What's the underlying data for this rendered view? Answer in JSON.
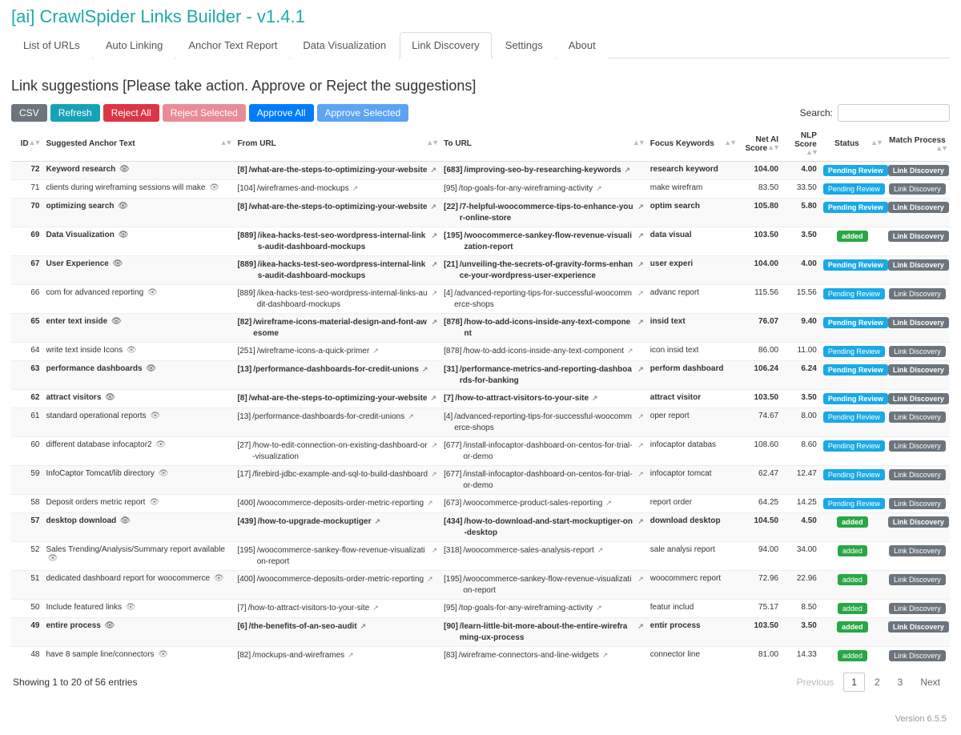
{
  "app_title": "[ai] CrawlSpider Links Builder - v1.4.1",
  "tabs": [
    "List of URLs",
    "Auto Linking",
    "Anchor Text Report",
    "Data Visualization",
    "Link Discovery",
    "Settings",
    "About"
  ],
  "active_tab": 4,
  "subtitle": "Link suggestions [Please take action. Approve or Reject the suggestions]",
  "toolbar": {
    "csv": "CSV",
    "refresh": "Refresh",
    "reject_all": "Reject All",
    "reject_selected": "Reject Selected",
    "approve_all": "Approve All",
    "approve_selected": "Approve Selected"
  },
  "search_label": "Search:",
  "columns": {
    "id": "ID",
    "anchor": "Suggested Anchor Text",
    "from": "From URL",
    "to": "To URL",
    "focus": "Focus Keywords",
    "net": "Net AI Score",
    "nlp": "NLP Score",
    "status": "Status",
    "match": "Match Process"
  },
  "status_labels": {
    "pending": "Pending Review",
    "added": "added"
  },
  "match_label": "Link Discovery",
  "rows": [
    {
      "id": 72,
      "bold": true,
      "anchor": "Keyword research",
      "from_id": 8,
      "from": "/what-are-the-steps-to-optimizing-your-website",
      "to_id": 683,
      "to": "/improving-seo-by-researching-keywords",
      "focus": "research keyword",
      "net": "104.00",
      "nlp": "4.00",
      "status": "pending"
    },
    {
      "id": 71,
      "bold": false,
      "anchor": "clients during wireframing sessions will make",
      "from_id": 104,
      "from": "/wireframes-and-mockups",
      "to_id": 95,
      "to": "/top-goals-for-any-wireframing-activity",
      "focus": "make wirefram",
      "net": "83.50",
      "nlp": "33.50",
      "status": "pending"
    },
    {
      "id": 70,
      "bold": true,
      "anchor": "optimizing search",
      "from_id": 8,
      "from": "/what-are-the-steps-to-optimizing-your-website",
      "to_id": 22,
      "to": "/7-helpful-woocommerce-tips-to-enhance-your-online-store",
      "focus": "optim search",
      "net": "105.80",
      "nlp": "5.80",
      "status": "pending"
    },
    {
      "id": 69,
      "bold": true,
      "anchor": "Data Visualization",
      "from_id": 889,
      "from": "/ikea-hacks-test-seo-wordpress-internal-links-audit-dashboard-mockups",
      "to_id": 195,
      "to": "/woocommerce-sankey-flow-revenue-visualization-report",
      "focus": "data visual",
      "net": "103.50",
      "nlp": "3.50",
      "status": "added"
    },
    {
      "id": 67,
      "bold": true,
      "anchor": "User Experience",
      "from_id": 889,
      "from": "/ikea-hacks-test-seo-wordpress-internal-links-audit-dashboard-mockups",
      "to_id": 21,
      "to": "/unveiling-the-secrets-of-gravity-forms-enhance-your-wordpress-user-experience",
      "focus": "user experi",
      "net": "104.00",
      "nlp": "4.00",
      "status": "pending"
    },
    {
      "id": 66,
      "bold": false,
      "anchor": "com for advanced reporting",
      "from_id": 889,
      "from": "/ikea-hacks-test-seo-wordpress-internal-links-audit-dashboard-mockups",
      "to_id": 4,
      "to": "/advanced-reporting-tips-for-successful-woocommerce-shops",
      "focus": "advanc report",
      "net": "115.56",
      "nlp": "15.56",
      "status": "pending"
    },
    {
      "id": 65,
      "bold": true,
      "anchor": "enter text inside",
      "from_id": 82,
      "from": "/wireframe-icons-material-design-and-font-awesome",
      "to_id": 878,
      "to": "/how-to-add-icons-inside-any-text-component",
      "focus": "insid text",
      "net": "76.07",
      "nlp": "9.40",
      "status": "pending"
    },
    {
      "id": 64,
      "bold": false,
      "anchor": "write text inside Icons",
      "from_id": 251,
      "from": "/wireframe-icons-a-quick-primer",
      "to_id": 878,
      "to": "/how-to-add-icons-inside-any-text-component",
      "focus": "icon insid text",
      "net": "86.00",
      "nlp": "11.00",
      "status": "pending"
    },
    {
      "id": 63,
      "bold": true,
      "anchor": "performance dashboards",
      "from_id": 13,
      "from": "/performance-dashboards-for-credit-unions",
      "to_id": 31,
      "to": "/performance-metrics-and-reporting-dashboards-for-banking",
      "focus": "perform dashboard",
      "net": "106.24",
      "nlp": "6.24",
      "status": "pending"
    },
    {
      "id": 62,
      "bold": true,
      "anchor": "attract visitors",
      "from_id": 8,
      "from": "/what-are-the-steps-to-optimizing-your-website",
      "to_id": 7,
      "to": "/how-to-attract-visitors-to-your-site",
      "focus": "attract visitor",
      "net": "103.50",
      "nlp": "3.50",
      "status": "pending"
    },
    {
      "id": 61,
      "bold": false,
      "anchor": "standard operational reports",
      "from_id": 13,
      "from": "/performance-dashboards-for-credit-unions",
      "to_id": 4,
      "to": "/advanced-reporting-tips-for-successful-woocommerce-shops",
      "focus": "oper report",
      "net": "74.67",
      "nlp": "8.00",
      "status": "pending"
    },
    {
      "id": 60,
      "bold": false,
      "anchor": "different database infocaptor2",
      "from_id": 27,
      "from": "/how-to-edit-connection-on-existing-dashboard-or-visualization",
      "to_id": 677,
      "to": "/install-infocaptor-dashboard-on-centos-for-trial-or-demo",
      "focus": "infocaptor databas",
      "net": "108.60",
      "nlp": "8.60",
      "status": "pending"
    },
    {
      "id": 59,
      "bold": false,
      "anchor": "InfoCaptor Tomcat/lib directory",
      "from_id": 17,
      "from": "/firebird-jdbc-example-and-sql-to-build-dashboard",
      "to_id": 677,
      "to": "/install-infocaptor-dashboard-on-centos-for-trial-or-demo",
      "focus": "infocaptor tomcat",
      "net": "62.47",
      "nlp": "12.47",
      "status": "pending"
    },
    {
      "id": 58,
      "bold": false,
      "anchor": "Deposit orders metric report",
      "from_id": 400,
      "from": "/woocommerce-deposits-order-metric-reporting",
      "to_id": 673,
      "to": "/woocommerce-product-sales-reporting",
      "focus": "report order",
      "net": "64.25",
      "nlp": "14.25",
      "status": "pending"
    },
    {
      "id": 57,
      "bold": true,
      "anchor": "desktop download",
      "from_id": 439,
      "from": "/how-to-upgrade-mockuptiger",
      "to_id": 434,
      "to": "/how-to-download-and-start-mockuptiger-on-desktop",
      "focus": "download desktop",
      "net": "104.50",
      "nlp": "4.50",
      "status": "added"
    },
    {
      "id": 52,
      "bold": false,
      "anchor": "Sales Trending/Analysis/Summary report available",
      "from_id": 195,
      "from": "/woocommerce-sankey-flow-revenue-visualization-report",
      "to_id": 318,
      "to": "/woocommerce-sales-analysis-report",
      "focus": "sale analysi report",
      "net": "94.00",
      "nlp": "34.00",
      "status": "added"
    },
    {
      "id": 51,
      "bold": false,
      "anchor": "dedicated dashboard report for woocommerce",
      "from_id": 400,
      "from": "/woocommerce-deposits-order-metric-reporting",
      "to_id": 195,
      "to": "/woocommerce-sankey-flow-revenue-visualization-report",
      "focus": "woocommerc report",
      "net": "72.96",
      "nlp": "22.96",
      "status": "added"
    },
    {
      "id": 50,
      "bold": false,
      "anchor": "Include featured links",
      "from_id": 7,
      "from": "/how-to-attract-visitors-to-your-site",
      "to_id": 95,
      "to": "/top-goals-for-any-wireframing-activity",
      "focus": "featur includ",
      "net": "75.17",
      "nlp": "8.50",
      "status": "added"
    },
    {
      "id": 49,
      "bold": true,
      "anchor": "entire process",
      "from_id": 6,
      "from": "/the-benefits-of-an-seo-audit",
      "to_id": 90,
      "to": "/learn-little-bit-more-about-the-entire-wireframing-ux-process",
      "focus": "entir process",
      "net": "103.50",
      "nlp": "3.50",
      "status": "added"
    },
    {
      "id": 48,
      "bold": false,
      "anchor": "have 8 sample line/connectors",
      "from_id": 82,
      "from": "/mockups-and-wireframes",
      "to_id": 83,
      "to": "/wireframe-connectors-and-line-widgets",
      "focus": "connector line",
      "net": "81.00",
      "nlp": "14.33",
      "status": "added"
    }
  ],
  "footer": {
    "showing": "Showing 1 to 20 of 56 entries"
  },
  "pagination": {
    "prev": "Previous",
    "pages": [
      "1",
      "2",
      "3"
    ],
    "active": 0,
    "next": "Next"
  },
  "version": "Version 6.5.5"
}
